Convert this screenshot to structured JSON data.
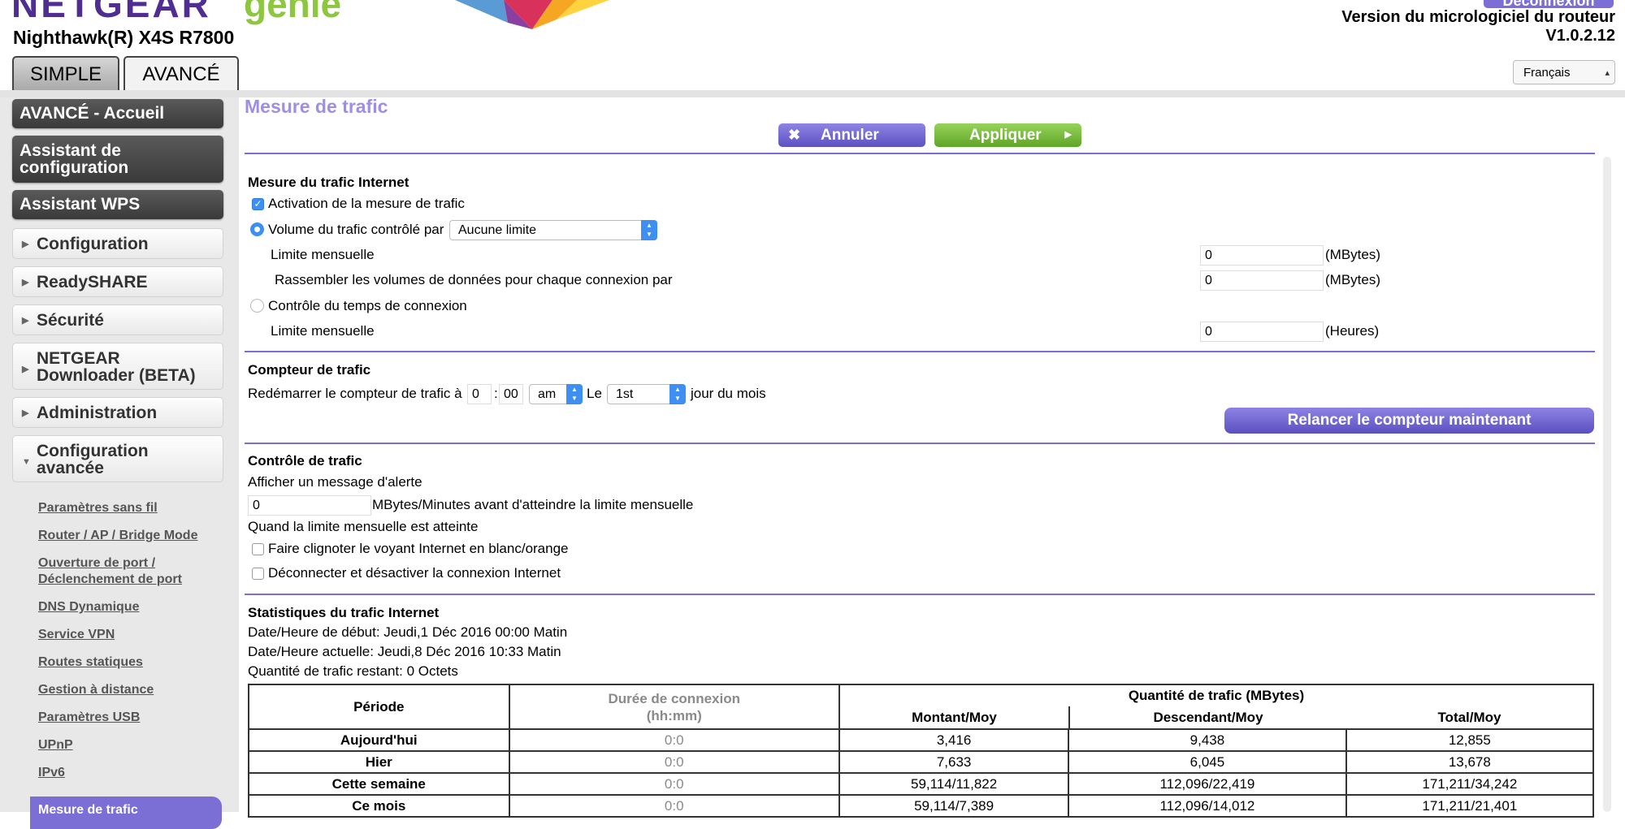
{
  "header": {
    "brand": "NETGEAR",
    "product": "genie",
    "model": "Nighthawk(R) X4S R7800",
    "logout": "Déconnexion",
    "firmware_label": "Version du micrologiciel du routeur",
    "firmware_version": "V1.0.2.12",
    "language": "Français"
  },
  "tabs": {
    "simple": "SIMPLE",
    "avance": "AVANCÉ"
  },
  "sidebar": {
    "home": "AVANCÉ - Accueil",
    "setup_wizard": "Assistant de configuration",
    "wps_wizard": "Assistant WPS",
    "menus": {
      "configuration": "Configuration",
      "readyshare": "ReadySHARE",
      "securite": "Sécurité",
      "downloader": "NETGEAR Downloader (BETA)",
      "administration": "Administration",
      "config_avancee": "Configuration avancée"
    },
    "links": {
      "wireless": "Paramètres sans fil",
      "router_ap": "Router / AP / Bridge Mode",
      "port_fwd": "Ouverture de port / Déclenchement de port",
      "ddns": "DNS Dynamique",
      "vpn": "Service VPN",
      "static_routes": "Routes statiques",
      "remote": "Gestion à distance",
      "usb": "Paramètres USB",
      "upnp": "UPnP",
      "ipv6": "IPv6",
      "traffic": "Mesure de trafic"
    }
  },
  "main": {
    "title": "Mesure de trafic",
    "cancel": "Annuler",
    "apply": "Appliquer",
    "internet": {
      "title": "Mesure du trafic Internet",
      "enable": "Activation de la mesure de trafic",
      "volume_label": "Volume du trafic contrôlé par",
      "volume_value": "Aucune limite",
      "monthly_limit": "Limite mensuelle",
      "monthly_limit_value": "0",
      "monthly_unit": "(MBytes)",
      "round_up": "Rassembler les volumes de données pour chaque connexion par",
      "round_up_value": "0",
      "round_up_unit": "(MBytes)",
      "time_control": "Contrôle du temps de connexion",
      "time_limit": "Limite mensuelle",
      "time_limit_value": "0",
      "time_unit": "(Heures)"
    },
    "counter": {
      "title": "Compteur de trafic",
      "restart_label": "Redémarrer le compteur de trafic à",
      "hour": "0",
      "sep": ":",
      "minute": "00",
      "ampm": "am",
      "le": "Le",
      "day": "1st",
      "day_suffix": "jour du mois",
      "reset_now": "Relancer le compteur maintenant"
    },
    "control": {
      "title": "Contrôle de trafic",
      "alert": "Afficher un message d'alerte",
      "alert_value": "0",
      "alert_suffix": "MBytes/Minutes avant d'atteindre la limite mensuelle",
      "when_reached": "Quand la limite mensuelle est atteinte",
      "blink": "Faire clignoter le voyant Internet en blanc/orange",
      "disconnect": "Déconnecter et désactiver la connexion Internet"
    },
    "stats": {
      "title": "Statistiques du trafic Internet",
      "start": "Date/Heure de début: Jeudi,1 Déc 2016 00:00 Matin",
      "current": "Date/Heure actuelle: Jeudi,8 Déc 2016 10:33 Matin",
      "remaining": "Quantité de trafic restant: 0 Octets",
      "headers": {
        "period": "Période",
        "duration": "Durée de connexion",
        "duration_unit": "(hh:mm)",
        "quantity": "Quantité de trafic (MBytes)",
        "up": "Montant/Moy",
        "down": "Descendant/Moy",
        "total": "Total/Moy"
      },
      "rows": [
        {
          "period": "Aujourd'hui",
          "duration": "0:0",
          "up": "3,416",
          "down": "9,438",
          "total": "12,855"
        },
        {
          "period": "Hier",
          "duration": "0:0",
          "up": "7,633",
          "down": "6,045",
          "total": "13,678"
        },
        {
          "period": "Cette semaine",
          "duration": "0:0",
          "up": "59,114/11,822",
          "down": "112,096/22,419",
          "total": "171,211/34,242"
        },
        {
          "period": "Ce mois",
          "duration": "0:0",
          "up": "59,114/7,389",
          "down": "112,096/14,012",
          "total": "171,211/21,401"
        }
      ]
    }
  }
}
